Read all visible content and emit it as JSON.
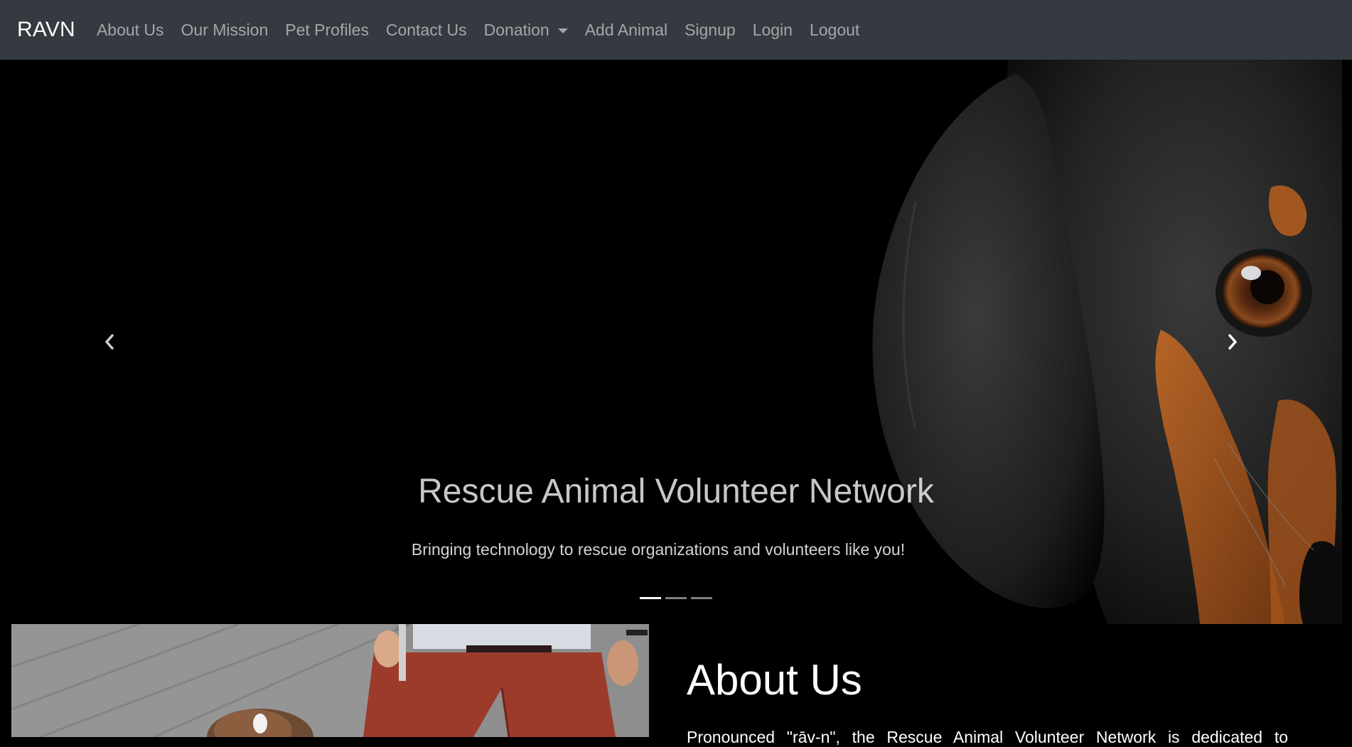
{
  "navbar": {
    "brand": "RAVN",
    "items": [
      {
        "label": "About Us"
      },
      {
        "label": "Our Mission"
      },
      {
        "label": "Pet Profiles"
      },
      {
        "label": "Contact Us"
      },
      {
        "label": "Donation"
      },
      {
        "label": "Add Animal"
      },
      {
        "label": "Signup"
      },
      {
        "label": "Login"
      },
      {
        "label": "Logout"
      }
    ],
    "background_color": "#343a40"
  },
  "carousel": {
    "title": "Rescue Animal Volunteer Network",
    "subtitle": "Bringing technology to rescue organizations and volunteers like you!",
    "slide_count": 3,
    "active_slide": 1,
    "prev_icon": "chevron-left-icon",
    "next_icon": "chevron-right-icon"
  },
  "about": {
    "heading": "About Us",
    "text": "Pronounced \"rāv-n\", the Rescue Animal Volunteer Network is dedicated to"
  }
}
